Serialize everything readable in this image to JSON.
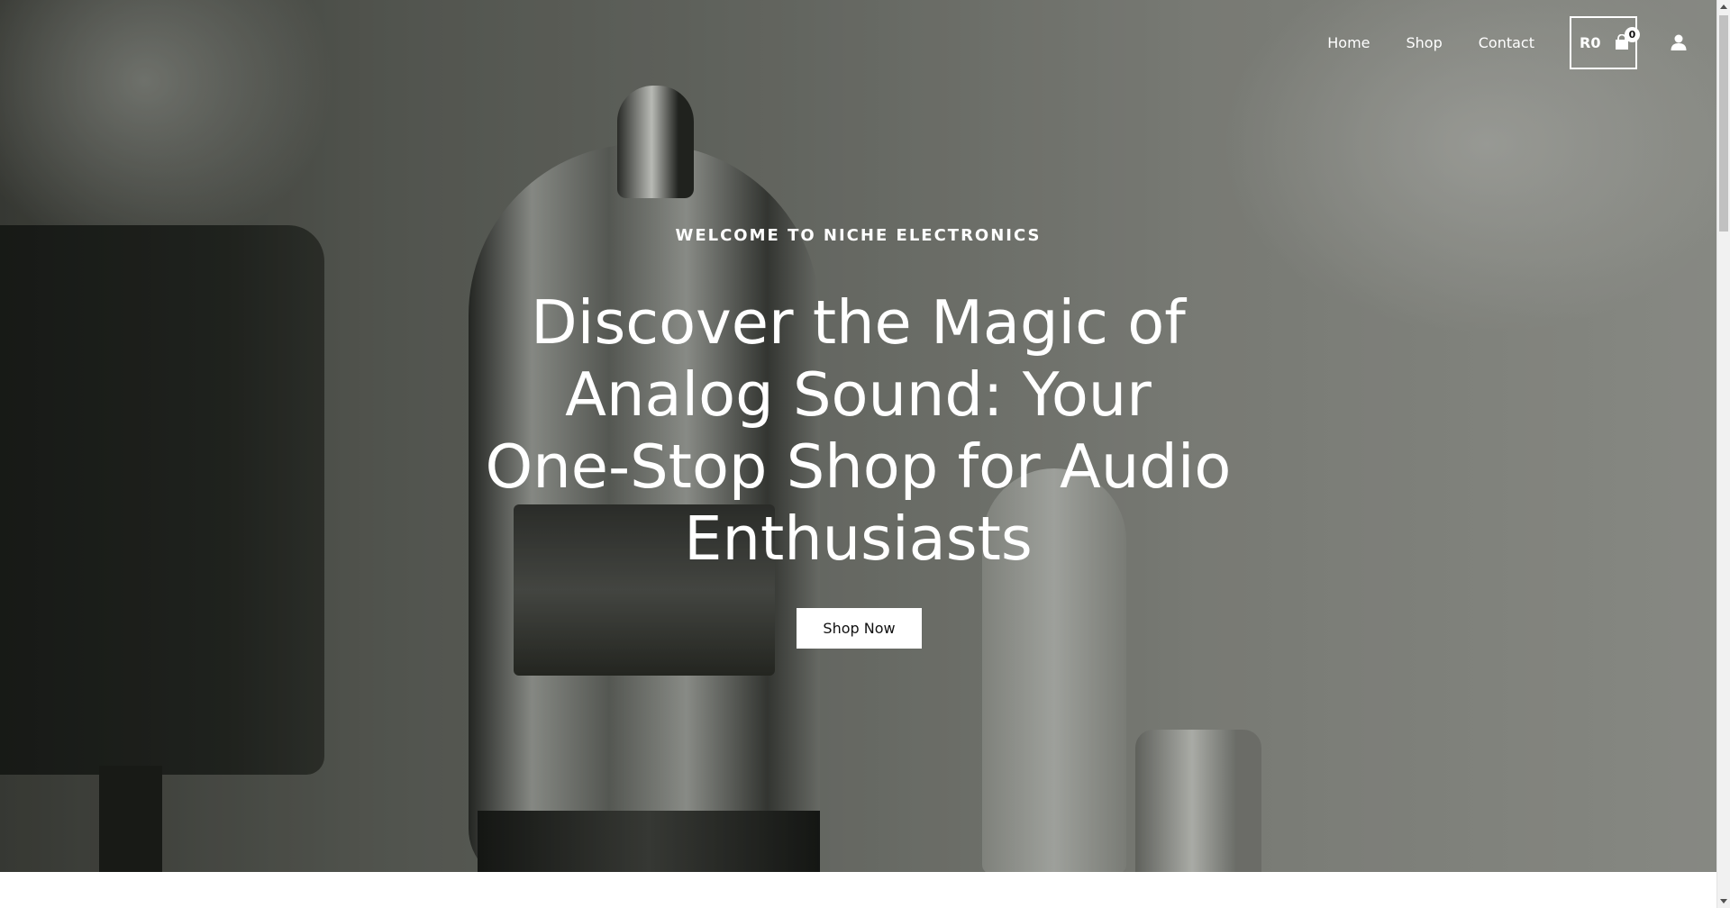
{
  "nav": {
    "links": [
      "Home",
      "Shop",
      "Contact"
    ],
    "cart_amount": "R0",
    "cart_count": "0",
    "cart_icon": "shopping-bag-icon",
    "account_icon": "user-icon"
  },
  "hero": {
    "eyebrow": "WELCOME TO NICHE ELECTRONICS",
    "headline": "Discover the Magic of Analog Sound: Your One-Stop Shop for Audio Enthusiasts",
    "cta_label": "Shop Now"
  },
  "colors": {
    "text_on_hero": "#ffffff",
    "button_bg": "#ffffff",
    "button_text": "#111111"
  }
}
